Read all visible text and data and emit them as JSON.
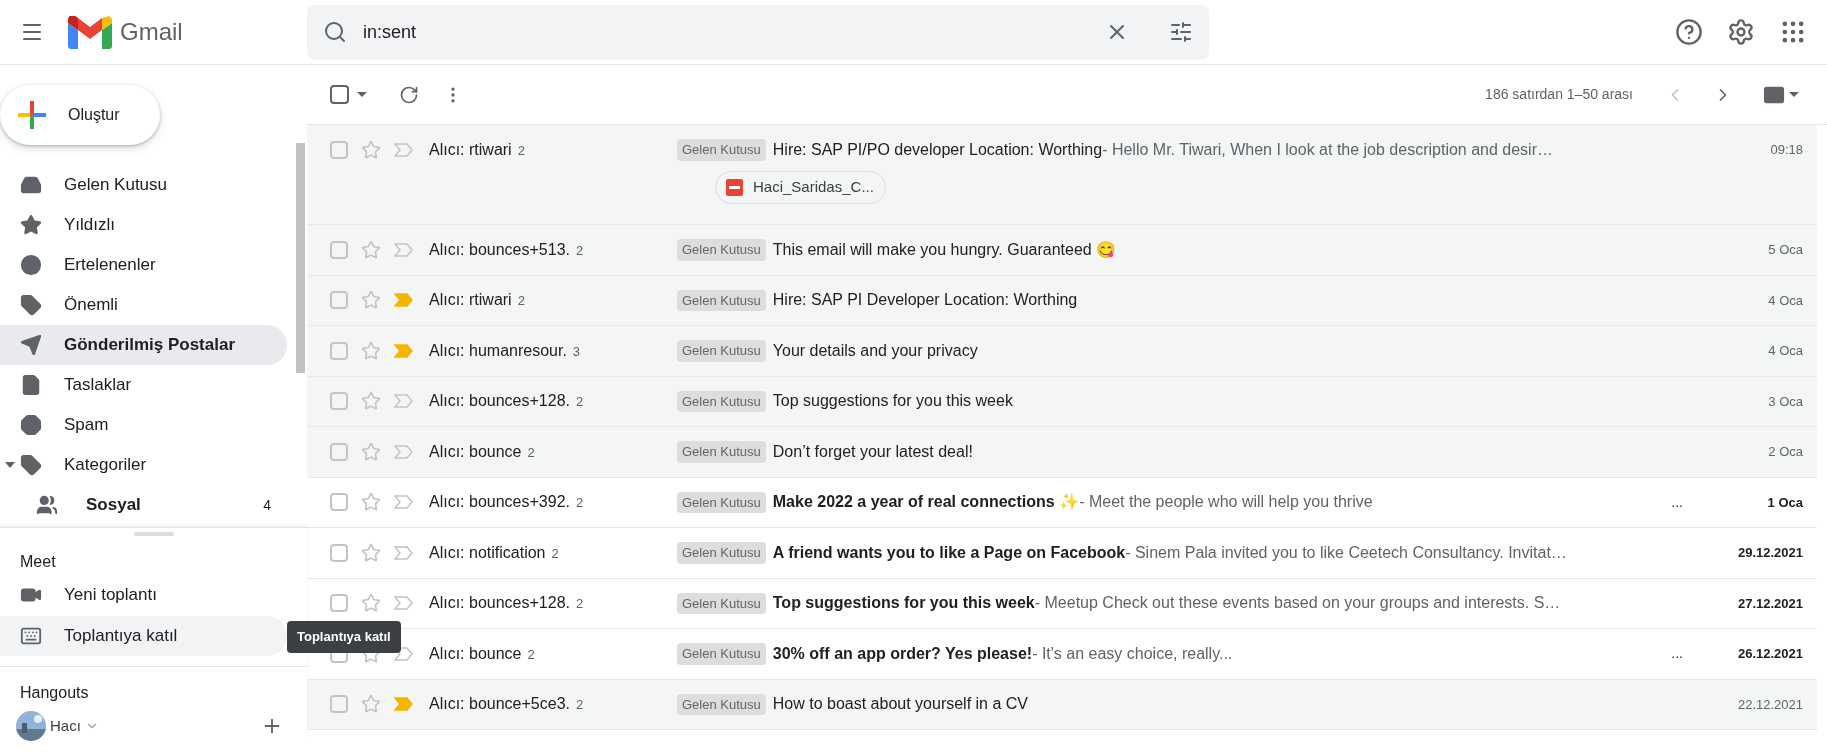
{
  "header": {
    "app_name": "Gmail",
    "search": {
      "value": "in:sent"
    }
  },
  "compose": {
    "label": "Oluştur"
  },
  "sidebar": {
    "items": [
      {
        "label": "Gelen Kutusu",
        "selected": false,
        "bold": false
      },
      {
        "label": "Yıldızlı",
        "selected": false,
        "bold": false
      },
      {
        "label": "Ertelenenler",
        "selected": false,
        "bold": false
      },
      {
        "label": "Önemli",
        "selected": false,
        "bold": false
      },
      {
        "label": "Gönderilmiş Postalar",
        "selected": true,
        "bold": true
      },
      {
        "label": "Taslaklar",
        "selected": false,
        "bold": false
      },
      {
        "label": "Spam",
        "selected": false,
        "bold": false
      },
      {
        "label": "Kategoriler",
        "selected": false,
        "bold": false,
        "expanded": true,
        "children": [
          {
            "label": "Sosyal",
            "count": "4",
            "bold": true
          }
        ]
      }
    ]
  },
  "meet": {
    "title": "Meet",
    "items": [
      {
        "label": "Yeni toplantı",
        "hovered": false
      },
      {
        "label": "Toplantıya katıl",
        "hovered": true
      }
    ],
    "tooltip": "Toplantıya katıl"
  },
  "hangouts": {
    "title": "Hangouts",
    "user": "Hacı"
  },
  "toolbar": {
    "select_all": {
      "checked": false
    },
    "range": "186 satırdan 1–50 arası"
  },
  "rows": [
    {
      "sender": "Alıcı: rtiwari",
      "count": "2",
      "label": "Gelen Kutusu",
      "subject": "Hire: SAP PI/PO developer Location: Worthing",
      "snippet": " - Hello Mr. Tiwari, When I look at the job description and desir…",
      "date": "09:18",
      "important": false,
      "unread": false,
      "attachment": "Haci_Saridas_C..."
    },
    {
      "sender": "Alıcı: bounces+513.",
      "count": "2",
      "label": "Gelen Kutusu",
      "subject": "This email will make you hungry. Guaranteed 😋",
      "date": "5 Oca",
      "important": false,
      "unread": false
    },
    {
      "sender": "Alıcı: rtiwari",
      "count": "2",
      "label": "Gelen Kutusu",
      "subject": "Hire: SAP PI Developer Location: Worthing",
      "date": "4 Oca",
      "important": true,
      "unread": false
    },
    {
      "sender": "Alıcı: humanresour.",
      "count": "3",
      "label": "Gelen Kutusu",
      "subject": "Your details and your privacy",
      "date": "4 Oca",
      "important": true,
      "unread": false
    },
    {
      "sender": "Alıcı: bounces+128.",
      "count": "2",
      "label": "Gelen Kutusu",
      "subject": "Top suggestions for you this week",
      "date": "3 Oca",
      "important": false,
      "unread": false
    },
    {
      "sender": "Alıcı: bounce",
      "count": "2",
      "label": "Gelen Kutusu",
      "subject": "Don’t forget your latest deal!",
      "date": "2 Oca",
      "important": false,
      "unread": false
    },
    {
      "sender": "Alıcı: bounces+392.",
      "count": "2",
      "label": "Gelen Kutusu",
      "subject": "Make 2022 a year of real connections ✨",
      "snippet": " - Meet the people who will help you thrive",
      "trail": "...",
      "date": "1 Oca",
      "important": false,
      "unread": true
    },
    {
      "sender": "Alıcı: notification",
      "count": "2",
      "label": "Gelen Kutusu",
      "subject": "A friend wants you to like a Page on Facebook",
      "snippet": " - Sinem Pala invited you to like Ceetech Consultancy. Invitat…",
      "date": "29.12.2021",
      "important": false,
      "unread": true
    },
    {
      "sender": "Alıcı: bounces+128.",
      "count": "2",
      "label": "Gelen Kutusu",
      "subject": "Top suggestions for you this week",
      "snippet": " - Meetup Check out these events based on your groups and interests. S…",
      "date": "27.12.2021",
      "important": false,
      "unread": true
    },
    {
      "sender": "Alıcı: bounce",
      "count": "2",
      "label": "Gelen Kutusu",
      "subject": "30% off an app order? Yes please!",
      "snippet": " - It's an easy choice, really...",
      "trail": "...",
      "date": "26.12.2021",
      "important": false,
      "unread": true
    },
    {
      "sender": "Alıcı: bounce+5ce3.",
      "count": "2",
      "label": "Gelen Kutusu",
      "subject": "How to boast about yourself in a CV",
      "date": "22.12.2021",
      "important": true,
      "unread": false
    }
  ]
}
